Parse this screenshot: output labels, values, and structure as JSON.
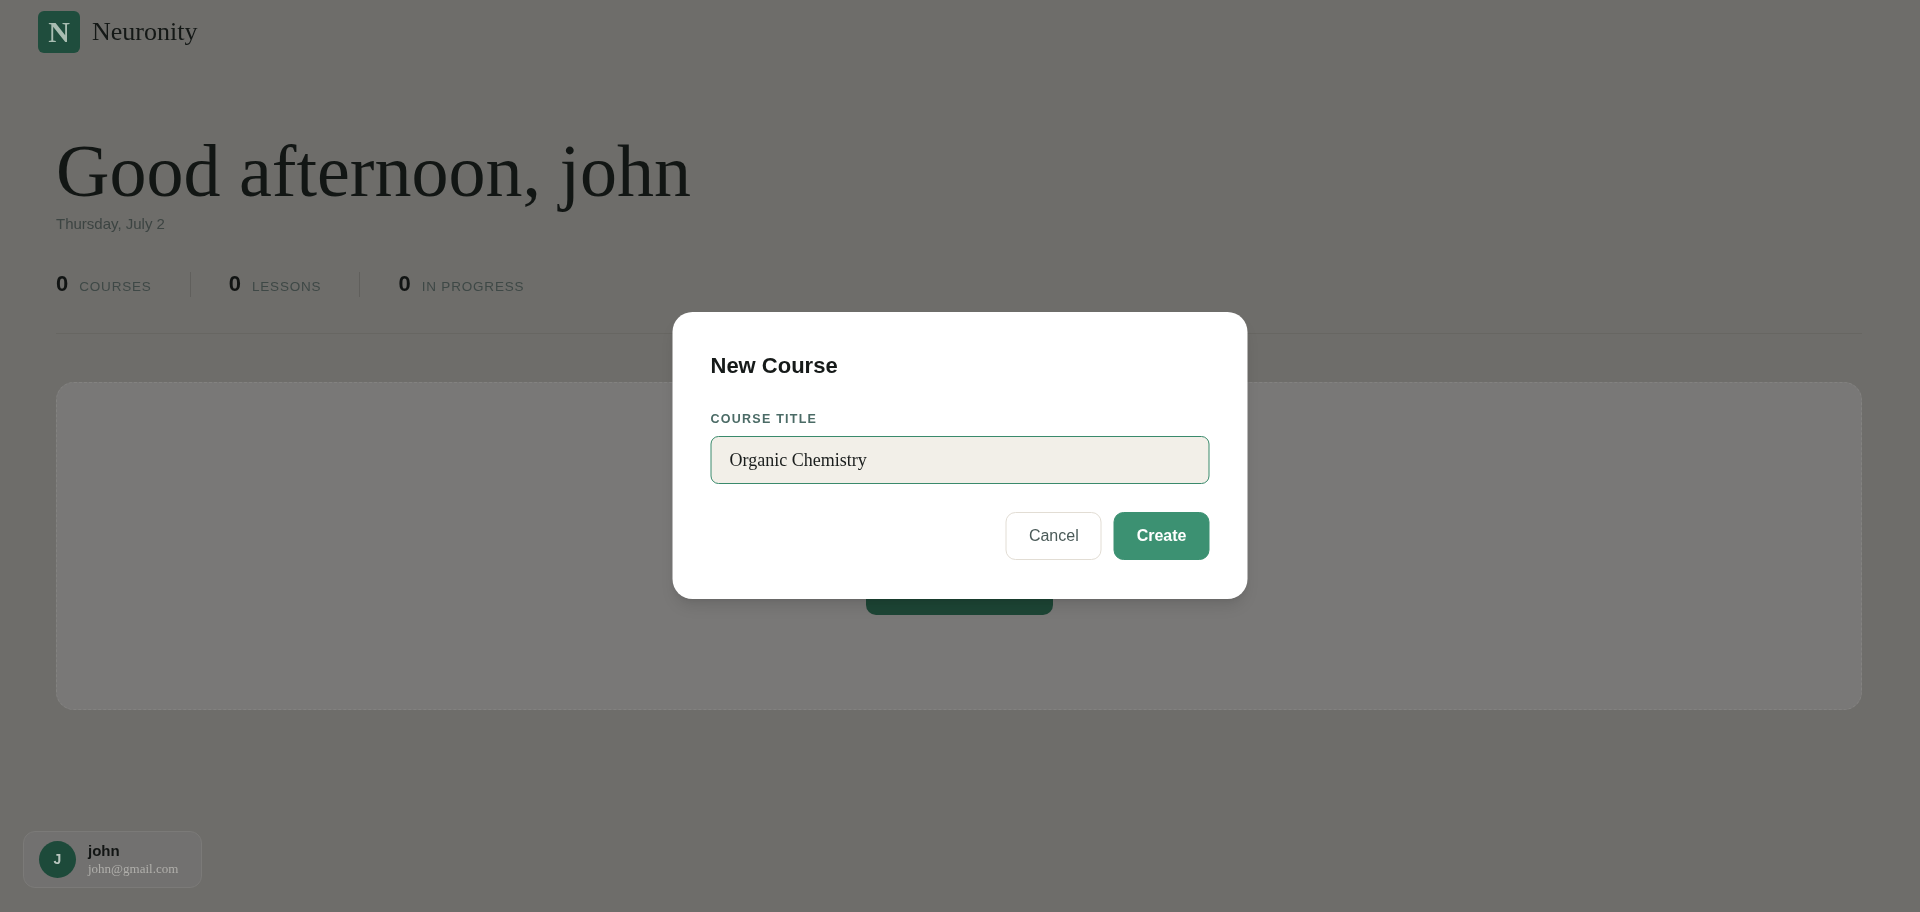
{
  "brand": {
    "logo_letter": "N",
    "name": "Neuronity"
  },
  "greeting": {
    "title": "Good afternoon, john",
    "date": "Thursday, July 2"
  },
  "stats": [
    {
      "value": "0",
      "label": "COURSES"
    },
    {
      "value": "0",
      "label": "LESSONS"
    },
    {
      "value": "0",
      "label": "IN PROGRESS"
    }
  ],
  "dialog": {
    "title": "New Course",
    "field": {
      "label": "COURSE TITLE",
      "value": "Organic Chemistry"
    },
    "buttons": [
      {
        "label": "Cancel",
        "kind": "secondary"
      },
      {
        "label": "Create",
        "kind": "primary"
      }
    ]
  },
  "user": {
    "initial": "J",
    "name": "john",
    "email": "john@gmail.com"
  }
}
